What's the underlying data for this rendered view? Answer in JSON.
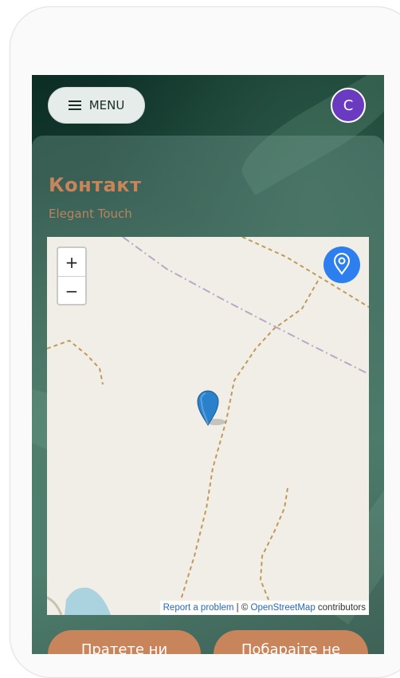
{
  "header": {
    "menu_label": "MENU",
    "avatar_initial": "C"
  },
  "page": {
    "title": "Контакт",
    "subtitle": "Elegant Touch"
  },
  "map": {
    "zoom_in_label": "+",
    "zoom_out_label": "−",
    "attribution": {
      "report_link": "Report a problem",
      "separator": " | © ",
      "osm_link": "OpenStreetMap",
      "suffix": " contributors"
    },
    "colors": {
      "background": "#f1eee8",
      "marker": "#2d7ff0",
      "path": "#c09a5a",
      "boundary": "#b9a9c5"
    }
  },
  "actions": {
    "follow_label": "Пратете ни",
    "visit_label": "Побарајте не"
  },
  "colors": {
    "accent": "#c8845a",
    "avatar": "#6a3bc0"
  }
}
